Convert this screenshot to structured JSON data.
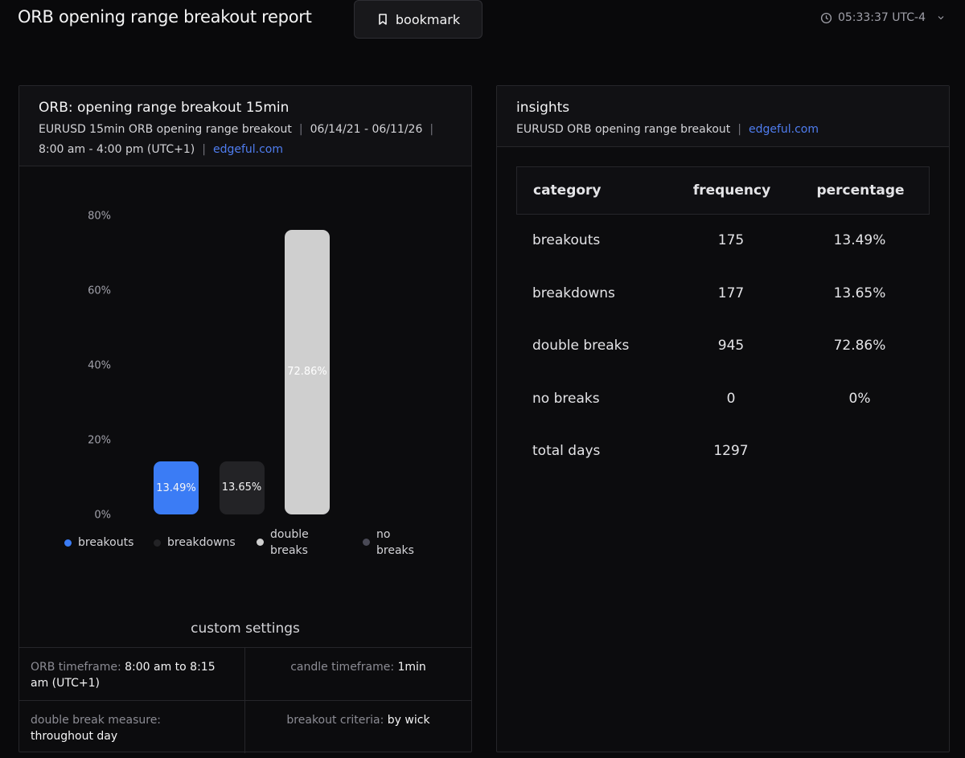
{
  "header": {
    "title": "ORB opening range breakout report",
    "bookmark_label": "bookmark",
    "clock": "05:33:37 UTC-4"
  },
  "left_panel": {
    "title": "ORB: opening range breakout 15min",
    "subtitle_parts": [
      "EURUSD 15min ORB opening range breakout",
      "06/14/21 - 06/11/26",
      "8:00 am - 4:00 pm (UTC+1)"
    ],
    "separator": "|",
    "link": "edgeful.com",
    "custom_settings_title": "custom settings",
    "settings": [
      {
        "key": "ORB timeframe:",
        "value": "8:00 am to 8:15 am (UTC+1)"
      },
      {
        "key": "candle timeframe:",
        "value": "1min"
      },
      {
        "key": "double break measure:",
        "value": "throughout day"
      },
      {
        "key": "breakout criteria:",
        "value": "by wick"
      }
    ]
  },
  "chart_data": {
    "type": "bar",
    "categories": [
      "breakouts",
      "breakdowns",
      "double breaks",
      "no breaks"
    ],
    "values": [
      13.49,
      13.65,
      72.86,
      0
    ],
    "data_labels": [
      "13.49%",
      "13.65%",
      "72.86%",
      ""
    ],
    "legend": [
      {
        "line1": "breakouts",
        "line2": ""
      },
      {
        "line1": "breakdowns",
        "line2": ""
      },
      {
        "line1": "double",
        "line2": "breaks"
      },
      {
        "line1": "no",
        "line2": "breaks"
      }
    ],
    "colors": [
      "#3b7cf5",
      "#232326",
      "#cfcfcf",
      "#4a4a56"
    ],
    "y_ticks": [
      "0%",
      "20%",
      "40%",
      "60%",
      "80%"
    ],
    "ylim": [
      0,
      80
    ],
    "grid": false,
    "legend_placement": "bottom"
  },
  "right_panel": {
    "title": "insights",
    "subtitle": "EURUSD ORB opening range breakout",
    "separator": "|",
    "link": "edgeful.com",
    "columns": [
      "category",
      "frequency",
      "percentage"
    ],
    "rows": [
      {
        "category": "breakouts",
        "frequency": "175",
        "percentage": "13.49%"
      },
      {
        "category": "breakdowns",
        "frequency": "177",
        "percentage": "13.65%"
      },
      {
        "category": "double breaks",
        "frequency": "945",
        "percentage": "72.86%"
      },
      {
        "category": "no breaks",
        "frequency": "0",
        "percentage": "0%"
      },
      {
        "category": "total days",
        "frequency": "1297",
        "percentage": ""
      }
    ]
  }
}
